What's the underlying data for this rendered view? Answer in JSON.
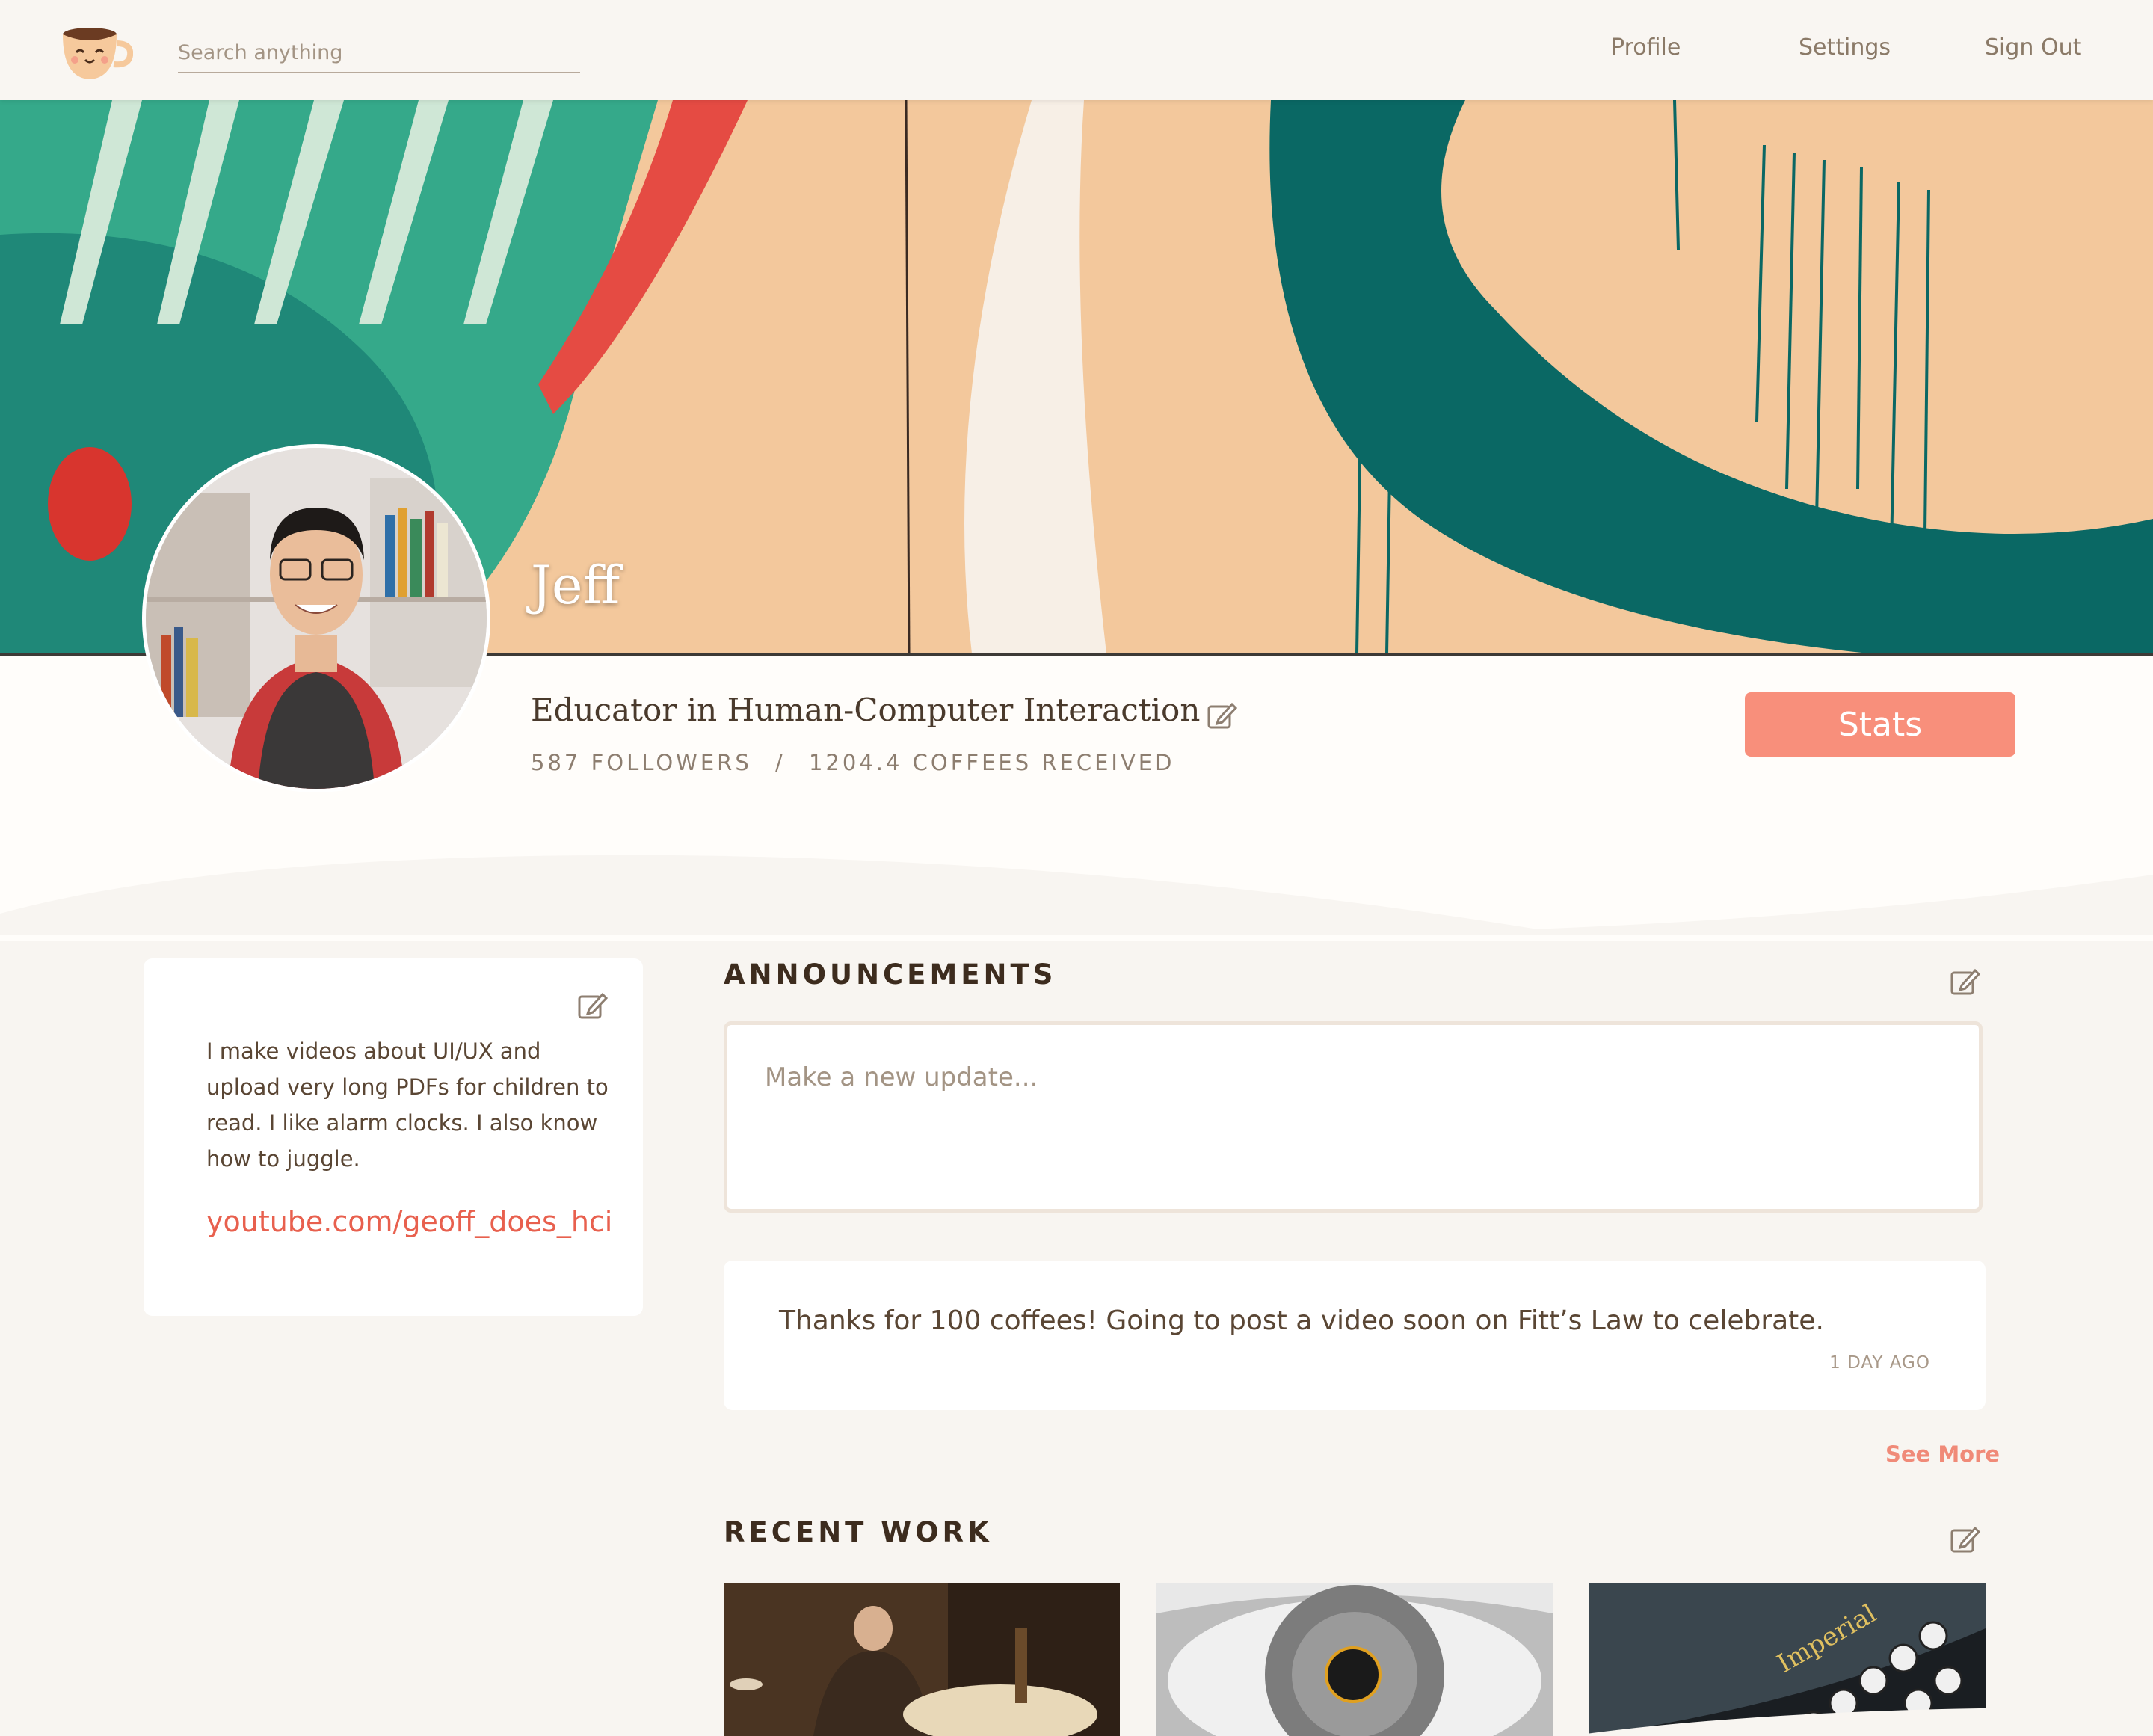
{
  "header": {
    "search_placeholder": "Search anything",
    "nav": [
      "Profile",
      "Settings",
      "Sign Out"
    ]
  },
  "profile": {
    "name": "Jeff",
    "tagline": "Educator in Human-Computer Interaction",
    "followers": "587 FOLLOWERS",
    "separator": "/",
    "coffees": "1204.4 COFFEES RECEIVED",
    "stats_button": "Stats"
  },
  "bio": {
    "text": "I make videos about UI/UX and upload very long PDFs for children to read. I like alarm clocks. I also know how to juggle.",
    "link": "youtube.com/geoff_does_hci"
  },
  "announcements": {
    "title": "ANNOUNCEMENTS",
    "placeholder": "Make a new update...",
    "items": [
      {
        "text": "Thanks for 100 coffees! Going to post a video soon on Fitt’s Law to celebrate.",
        "time": "1 DAY AGO"
      }
    ],
    "see_more": "See More"
  },
  "recent_work": {
    "title": "RECENT WORK",
    "items": [
      {
        "icon": "painting-thumbnail"
      },
      {
        "icon": "eye-thumbnail"
      },
      {
        "icon": "typewriter-thumbnail",
        "text": "Imperial"
      }
    ]
  },
  "colors": {
    "accent": "#f88f7b",
    "link": "#e8604e",
    "background": "#f8f5f1"
  }
}
